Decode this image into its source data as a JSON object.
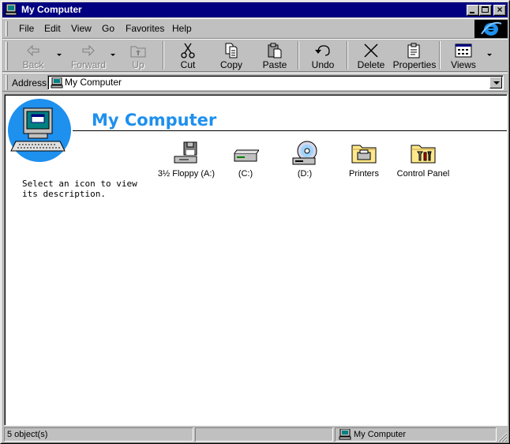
{
  "window": {
    "title": "My Computer"
  },
  "menu": {
    "items": [
      {
        "label": "File"
      },
      {
        "label": "Edit"
      },
      {
        "label": "View"
      },
      {
        "label": "Go"
      },
      {
        "label": "Favorites"
      },
      {
        "label": "Help"
      }
    ]
  },
  "toolbar": {
    "buttons": [
      {
        "label": "Back",
        "enabled": false
      },
      {
        "label": "Forward",
        "enabled": false
      },
      {
        "label": "Up",
        "enabled": false
      },
      {
        "label": "Cut",
        "enabled": true
      },
      {
        "label": "Copy",
        "enabled": true
      },
      {
        "label": "Paste",
        "enabled": true
      },
      {
        "label": "Undo",
        "enabled": true
      },
      {
        "label": "Delete",
        "enabled": true
      },
      {
        "label": "Properties",
        "enabled": true
      },
      {
        "label": "Views",
        "enabled": true
      }
    ]
  },
  "address": {
    "label": "Address",
    "value": "My Computer"
  },
  "content": {
    "heading": "My Computer",
    "description": "Select an icon to view its description.",
    "heading_color": "#1e90ee",
    "items": [
      {
        "label": "3½ Floppy (A:)",
        "icon": "floppy-drive-icon"
      },
      {
        "label": "(C:)",
        "icon": "hard-drive-icon"
      },
      {
        "label": "(D:)",
        "icon": "cd-drive-icon"
      },
      {
        "label": "Printers",
        "icon": "printers-folder-icon"
      },
      {
        "label": "Control Panel",
        "icon": "control-panel-folder-icon"
      }
    ]
  },
  "status": {
    "object_count": "5 object(s)",
    "location": "My Computer"
  },
  "colors": {
    "titlebar": "#000080",
    "face": "#c0c0c0"
  }
}
